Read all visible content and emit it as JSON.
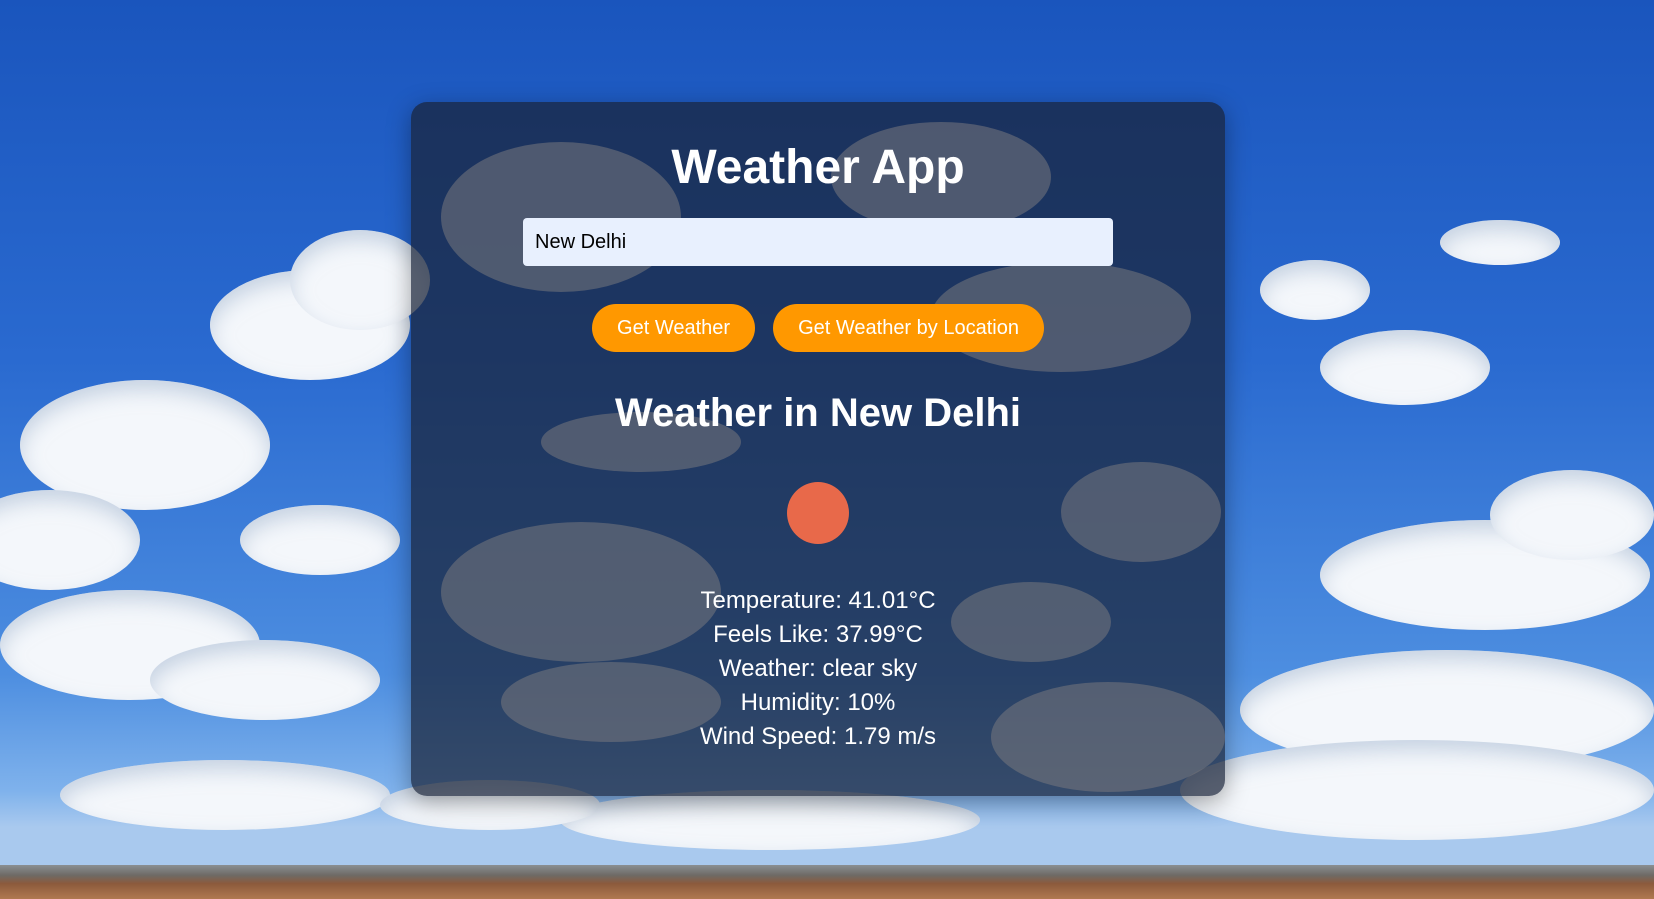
{
  "app": {
    "title": "Weather App"
  },
  "search": {
    "value": "New Delhi",
    "placeholder": ""
  },
  "buttons": {
    "get_weather": "Get Weather",
    "get_weather_by_location": "Get Weather by Location"
  },
  "result": {
    "heading": "Weather in New Delhi",
    "icon": "sun-icon",
    "temperature": "Temperature: 41.01°C",
    "feels_like": "Feels Like: 37.99°C",
    "weather": "Weather: clear sky",
    "humidity": "Humidity: 10%",
    "wind_speed": "Wind Speed: 1.79 m/s"
  },
  "colors": {
    "button_bg": "#ff9800",
    "input_bg": "#e8f0fe",
    "sun": "#e8694a"
  }
}
